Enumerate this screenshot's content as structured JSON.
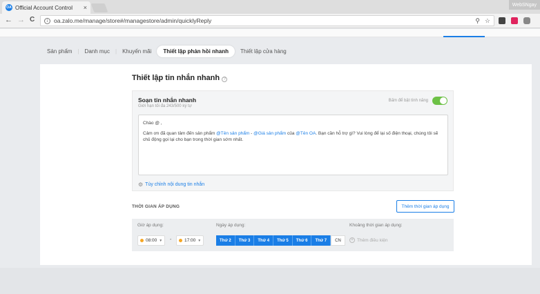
{
  "browser": {
    "tab_title": "Official Account Control",
    "tab_close": "×",
    "favicon_text": "OA",
    "corner_user": "WebSNgay",
    "url": "oa.zalo.me/manage/store#/managestore/admin/quicklyReply",
    "back": "←",
    "forward": "→",
    "reload": "C"
  },
  "subnav": {
    "items": [
      "Sản phẩm",
      "Danh mục",
      "Khuyến mãi",
      "Thiết lập phản hồi nhanh",
      "Thiết lập cửa hàng"
    ],
    "active": "Thiết lập phản hồi nhanh"
  },
  "page": {
    "title": "Thiết lập tin nhắn nhanh",
    "help": "?"
  },
  "compose": {
    "title": "Soạn tin nhắn nhanh",
    "subtitle": "Giới hạn tối đa 243/500 ký tự",
    "toggle_label": "Bấm để bật tính năng",
    "toggle_on": true,
    "greeting": "Chào @ ,",
    "line1_a": "Cảm ơn đã quan tâm đến sản phẩm ",
    "tag_product": "@Tên sản phẩm",
    "sep": " - ",
    "tag_price": "@Giá sản phẩm",
    "line1_b": " của ",
    "tag_oa": "@Tên OA",
    "line1_c": ". Bạn cần hỗ trợ gì? Vui lòng để lại số điện thoại, chúng tôi sẽ chủ động gọi lại cho bạn trong thời gian sớm nhất.",
    "customize_link": "Tùy chỉnh nội dung tin nhắn"
  },
  "schedule": {
    "title": "THỜI GIAN ÁP DỤNG",
    "add_button": "Thêm thời gian áp dụng",
    "time_label": "Giờ áp dụng:",
    "day_label": "Ngày áp dụng:",
    "range_label": "Khoảng thời gian áp dụng:",
    "start_time": "08:00",
    "end_time": "17:00",
    "dash": "-",
    "days": [
      "Thứ 2",
      "Thứ 3",
      "Thứ 4",
      "Thứ 5",
      "Thứ 6",
      "Thứ 7"
    ],
    "day_off": "CN",
    "add_condition": "Thêm điều kiện"
  },
  "colors": {
    "accent": "#1a7ee6",
    "toggle": "#6dc146"
  }
}
